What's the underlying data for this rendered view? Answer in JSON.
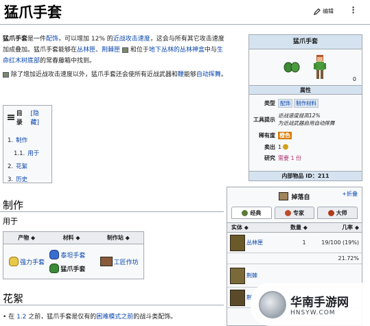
{
  "page": {
    "title": "猛爪手套",
    "edit_label": "编辑",
    "more_label": "⋮"
  },
  "intro": {
    "p1_a": "猛爪手套",
    "p1_b": "是一件",
    "p1_link1": "配饰",
    "p1_c": "，可以增加 12% 的",
    "p1_link2": "近战攻击速度",
    "p1_d": "，这会与所有其它攻击速度加成叠加。猛爪手套能够在",
    "p1_link3": "丛林匣",
    "p1_e": "、",
    "p1_link4": "荆棘匣",
    "p1_f": "和位于",
    "p1_link5": "地下丛林的丛林神盒",
    "p1_g": "中与",
    "p1_link6": "生命红木树底部",
    "p1_h": "的常春藤箱中找到。",
    "p2_a": "除了增加近战攻击速度以外，猛爪手套还会使所有近战武器和",
    "p2_link": "鞭",
    "p2_b": "能够",
    "p2_link2": "自动挥舞",
    "p2_c": "。"
  },
  "toc": {
    "heading": "目录",
    "hide": "[隐藏]",
    "items": [
      {
        "num": "1.",
        "text": "制作"
      },
      {
        "num": "1.1.",
        "text": "用于"
      },
      {
        "num": "2.",
        "text": "花絮"
      },
      {
        "num": "3.",
        "text": "历史"
      }
    ]
  },
  "sections": {
    "crafting": "制作",
    "used_in": "用于",
    "trivia": "花絮",
    "trivia_text_a": "在",
    "trivia_link1": "1.2",
    "trivia_text_b": "之前，猛爪手套是仅有的",
    "trivia_link2": "困难模式之前",
    "trivia_text_c": "的战斗类配饰。"
  },
  "used_table": {
    "headers": [
      "产物",
      "材料",
      "制作站"
    ],
    "product": "强力手套",
    "materials": [
      "泰坦手套",
      "猛爪手套"
    ],
    "station": "工匠作坊"
  },
  "infobox": {
    "title": "猛爪手套",
    "number": "0",
    "attr_header": "属性",
    "rows": [
      {
        "key": "类型",
        "tags": [
          "配饰",
          "制作材料"
        ]
      },
      {
        "key": "工具提示",
        "lines": [
          "近战速度提高12%",
          "为近战武器启用自动挥舞"
        ]
      },
      {
        "key": "稀有度",
        "value": "橙色"
      },
      {
        "key": "卖出",
        "value": "1"
      },
      {
        "key": "研究",
        "value": "需要 1 份"
      }
    ],
    "footer": "内部物品 ID：211"
  },
  "drops": {
    "title": "掉落自",
    "fold": "折叠",
    "tabs": [
      "经典",
      "专家",
      "大师"
    ],
    "headers": [
      "实体",
      "数量",
      "几率"
    ],
    "rows": [
      {
        "entity": "丛林匣",
        "qty": "1",
        "chance": "19/100 (19%)"
      },
      {
        "entity": "",
        "qty": "",
        "chance": "21.72%"
      },
      {
        "entity": "荆棘",
        "qty": "",
        "chance": ""
      },
      {
        "entity": "荆",
        "qty": "",
        "chance": ""
      }
    ]
  },
  "watermark": {
    "title": "华南手游网",
    "url": "HNSYW.COM"
  },
  "colors": {
    "link": "#0645ad",
    "infobox_header": "#d5e3f0",
    "rarity_orange": "#d97b00"
  }
}
